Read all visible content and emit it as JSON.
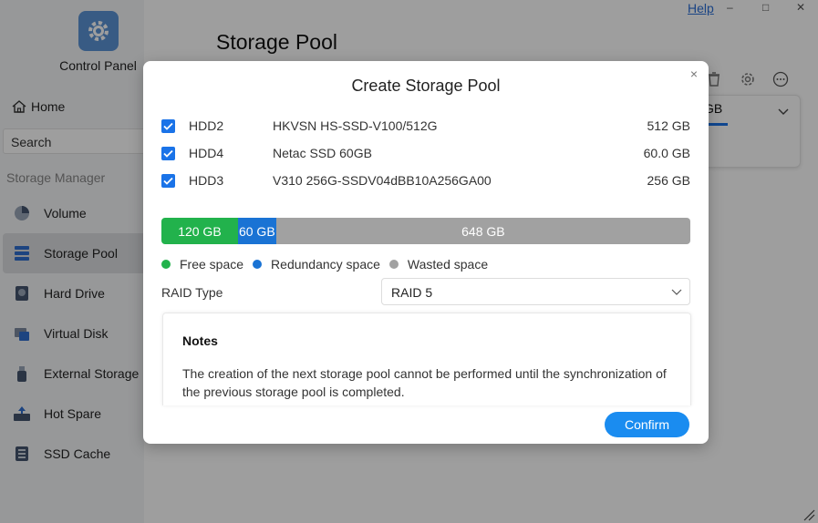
{
  "window": {
    "help_label": "Help",
    "minimize_glyph": "–",
    "maximize_glyph": "□",
    "close_glyph": "✕"
  },
  "sidebar": {
    "control_panel_label": "Control Panel",
    "home_label": "Home",
    "search_placeholder": "Search",
    "section_title": "Storage Manager",
    "items": [
      {
        "label": "Volume",
        "icon": "volume-icon"
      },
      {
        "label": "Storage Pool",
        "icon": "storage-pool-icon",
        "active": true
      },
      {
        "label": "Hard Drive",
        "icon": "hard-drive-icon"
      },
      {
        "label": "Virtual Disk",
        "icon": "virtual-disk-icon"
      },
      {
        "label": "External Storage",
        "icon": "external-storage-icon"
      },
      {
        "label": "Hot Spare",
        "icon": "hot-spare-icon"
      },
      {
        "label": "SSD Cache",
        "icon": "ssd-cache-icon"
      }
    ]
  },
  "main": {
    "page_title": "Storage Pool",
    "pool_card_text": "GB"
  },
  "modal": {
    "title": "Create Storage Pool",
    "close_glyph": "×",
    "disks": [
      {
        "checked": true,
        "name": "HDD2",
        "model": "HKVSN HS-SSD-V100/512G",
        "size": "512 GB"
      },
      {
        "checked": true,
        "name": "HDD4",
        "model": "Netac SSD 60GB",
        "size": "60.0 GB"
      },
      {
        "checked": true,
        "name": "HDD3",
        "model": "V310 256G-SSDV04dBB10A256GA00",
        "size": "256 GB"
      }
    ],
    "capacity": {
      "free_label": "120 GB",
      "redundancy_label": "60 GB",
      "wasted_label": "648 GB",
      "free_fraction": 0.1446,
      "redundancy_fraction": 0.0723,
      "wasted_fraction": 0.7831
    },
    "legend": {
      "free": "Free space",
      "redundancy": "Redundancy space",
      "wasted": "Wasted space"
    },
    "raid": {
      "label": "RAID Type",
      "value": "RAID 5"
    },
    "notes": {
      "title": "Notes",
      "text": "The creation of the next storage pool cannot be performed until the synchronization of the previous storage pool is completed."
    },
    "confirm_label": "Confirm"
  },
  "colors": {
    "accent": "#1a8cf0",
    "free": "#22b24c",
    "redundancy": "#1a73d4",
    "wasted": "#a1a1a1"
  }
}
